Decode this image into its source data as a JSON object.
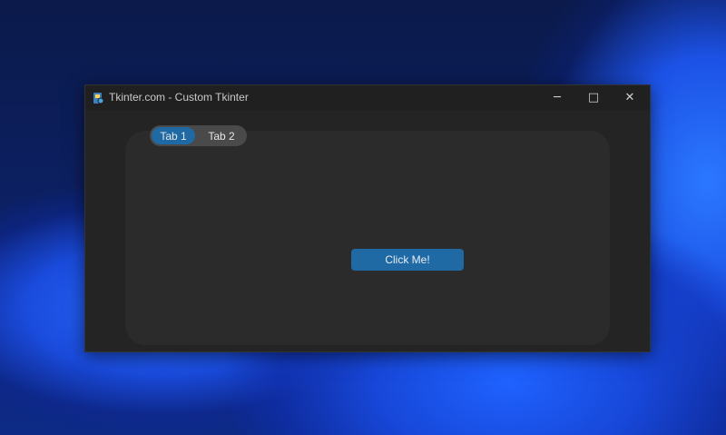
{
  "window": {
    "title": "Tkinter.com - Custom Tkinter",
    "app_icon": "python-file-icon",
    "controls": {
      "minimize": "─",
      "maximize": "□",
      "close": "✕"
    }
  },
  "tabs": [
    {
      "label": "Tab 1",
      "selected": true
    },
    {
      "label": "Tab 2",
      "selected": false
    }
  ],
  "main": {
    "button_label": "Click Me!"
  },
  "colors": {
    "accent": "#1f6aa5",
    "window_bg": "#242424",
    "frame_bg": "#2b2b2b",
    "segment_bg": "#4a4a4a"
  }
}
